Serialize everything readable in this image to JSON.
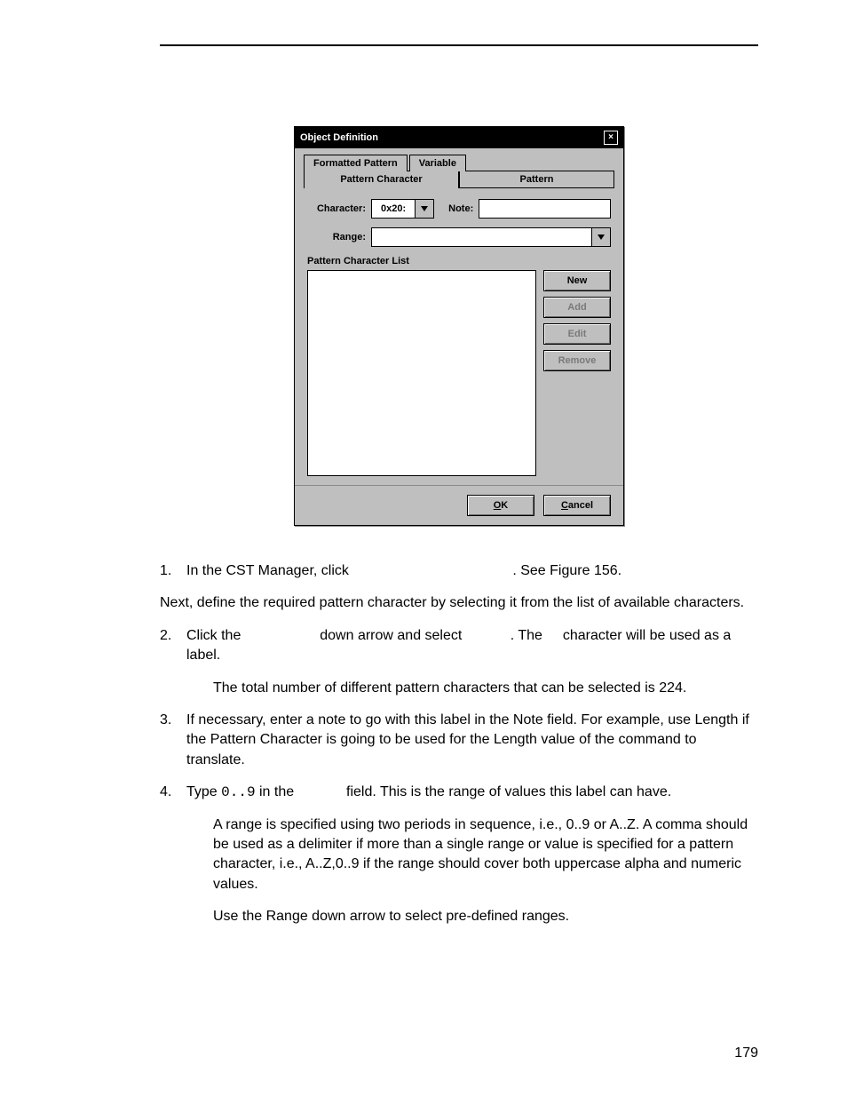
{
  "dialog": {
    "title": "Object Definition",
    "tabs": {
      "formatted_pattern": "Formatted Pattern",
      "variable": "Variable"
    },
    "subtabs": {
      "pattern_character": "Pattern Character",
      "pattern": "Pattern"
    },
    "labels": {
      "character": "Character:",
      "note": "Note:",
      "range": "Range:",
      "list_heading": "Pattern Character List"
    },
    "character_value": "0x20:",
    "buttons": {
      "new": "New",
      "add": "Add",
      "edit": "Edit",
      "remove": "Remove",
      "ok_prefix": "O",
      "ok_rest": "K",
      "cancel_prefix": "C",
      "cancel_rest": "ancel"
    }
  },
  "steps": {
    "s1": "In the CST Manager, click ",
    "s1_tail": ". See Figure 156.",
    "para_next": "Next, define the required pattern character by selecting it from the list of available characters.",
    "s2_a": "Click the ",
    "s2_b": " down arrow and select ",
    "s2_c": ". The ",
    "s2_d": " character will be used as a label.",
    "note2": "The total number of different pattern characters that can be selected is 224.",
    "s3": "If necessary, enter a note to go with this label in the Note field. For example, use Length if the Pattern Character is going to be used for the Length value of the command to translate.",
    "s4_a": "Type ",
    "s4_code": "0..9",
    "s4_b": " in the ",
    "s4_c": " field. This is the range of values this label can have.",
    "note4a": "A range is specified using two periods in sequence, i.e., 0..9 or A..Z. A comma should be used as a delimiter if more than a single range or value is specified for a pattern character, i.e., A..Z,0..9 if the range should cover both uppercase alpha and numeric values.",
    "note4b": "Use the Range down arrow to select pre-defined ranges."
  },
  "nums": {
    "n1": "1.",
    "n2": "2.",
    "n3": "3.",
    "n4": "4."
  },
  "page_number": "179"
}
